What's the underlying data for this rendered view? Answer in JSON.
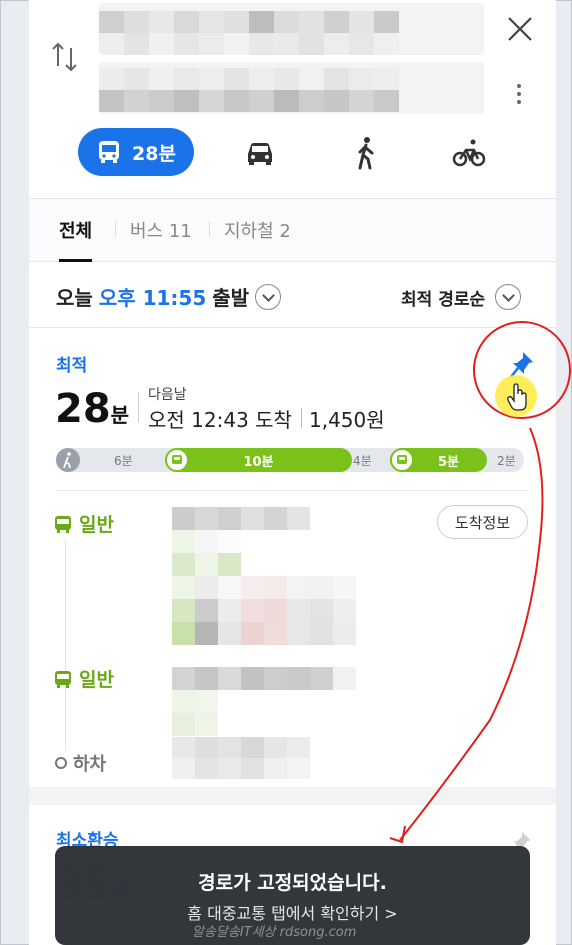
{
  "header": {
    "close_icon": "close-icon",
    "more_icon": "more-vertical-icon",
    "swap_icon": "swap-icon"
  },
  "modes": {
    "bus_label": "28분",
    "active": "bus"
  },
  "tabs": {
    "all": "전체",
    "bus": "버스 11",
    "subway": "지하철 2"
  },
  "departure": {
    "prefix": "오늘",
    "time": "오후 11:55",
    "suffix": "출발",
    "sort_label": "최적 경로순"
  },
  "route": {
    "tag": "최적",
    "duration_num": "28",
    "duration_unit": "분",
    "next_day": "다음날",
    "arrival": "오전 12:43 도착",
    "fare": "1,450원",
    "segments": [
      {
        "kind": "walk",
        "minutes": 6,
        "label": "6분"
      },
      {
        "kind": "bus",
        "minutes": 10,
        "label": "10분"
      },
      {
        "kind": "walk",
        "minutes": 4,
        "label": "4분"
      },
      {
        "kind": "bus",
        "minutes": 5,
        "label": "5분"
      },
      {
        "kind": "walk",
        "minutes": 2,
        "label": "2분"
      }
    ],
    "leg1": "일반",
    "leg2": "일반",
    "alight": "하차",
    "arrive_info": "도착정보"
  },
  "next_card": {
    "tag": "최소환승",
    "duration_num": "35",
    "duration_unit": "분"
  },
  "toast": {
    "title": "경로가 고정되었습니다.",
    "subtitle": "홈 대중교통 탭에서 확인하기 >"
  },
  "watermark": "알송달송IT세상 rdsong.com",
  "colors": {
    "accent": "#1a73e8",
    "bus_green": "#7ac11a",
    "annotation_red": "#e02020"
  }
}
